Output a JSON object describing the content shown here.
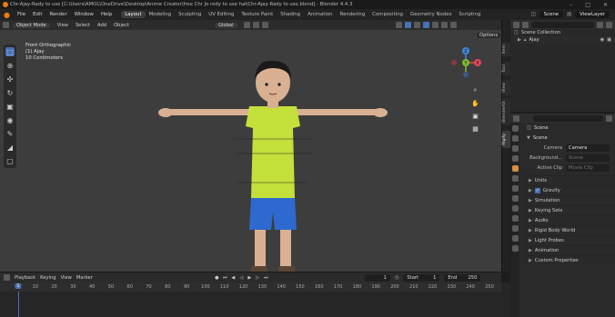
{
  "window": {
    "title": "Chr-Ajay-Rady to use [C:\\Users\\AMOL\\OneDrive\\Desktop\\Anime Creator\\free Chr Jo redy to use hal\\Chr-Ajay-Rady to use.blend] - Blender 4.4.3"
  },
  "menu": [
    "File",
    "Edit",
    "Render",
    "Window",
    "Help"
  ],
  "workspaces": [
    "Layout",
    "Modeling",
    "Sculpting",
    "UV Editing",
    "Texture Paint",
    "Shading",
    "Animation",
    "Rendering",
    "Compositing",
    "Geometry Nodes",
    "Scripting"
  ],
  "active_workspace_index": 0,
  "topbar_right": {
    "scene": "Scene",
    "view_layer": "ViewLayer"
  },
  "viewport_header": {
    "mode": "Object Mode",
    "menus": [
      "View",
      "Select",
      "Add",
      "Object"
    ],
    "orientation": "Global",
    "options": "Options"
  },
  "viewport_info": [
    "Front Orthographic",
    "(1) Ajay",
    "10 Centimeters"
  ],
  "gizmo_axes": {
    "x": "X",
    "y": "Y",
    "z": "Z",
    "x_color": "#e0475a",
    "y_color": "#7dbb2d",
    "z_color": "#3f87e0"
  },
  "n_panel_tabs": [
    "Item",
    "Tool",
    "View",
    "BlenderKit",
    "Rigify"
  ],
  "outliner": {
    "items": [
      "Scene Collection",
      "Ajay"
    ]
  },
  "properties": {
    "header": "Scene",
    "section": "Scene",
    "rows": [
      {
        "label": "Camera",
        "value": "Camera",
        "dim": false
      },
      {
        "label": "Background...",
        "value": "Scene",
        "dim": true
      },
      {
        "label": "Active Clip",
        "value": "Movie Clip",
        "dim": true
      }
    ],
    "subpanels": [
      "Units",
      "Gravity",
      "Simulation",
      "Keying Sets",
      "Audio",
      "Rigid Body World",
      "Light Probes",
      "Animation",
      "Custom Properties"
    ],
    "gravity_checked": true
  },
  "timeline_header": {
    "menus": [
      "Playback",
      "Keying",
      "View",
      "Marker"
    ],
    "current_frame": "1",
    "start_label": "Start",
    "start": "1",
    "end_label": "End",
    "end": "250"
  },
  "timeline_ruler": [
    "1",
    "10",
    "20",
    "30",
    "40",
    "50",
    "60",
    "70",
    "80",
    "90",
    "100",
    "110",
    "120",
    "130",
    "140",
    "150",
    "160",
    "170",
    "180",
    "190",
    "200",
    "210",
    "220",
    "230",
    "240",
    "250"
  ],
  "colors": {
    "accent": "#4772b3",
    "viewport_bg": "#3d3d3d",
    "shirt": "#c4e03a",
    "shorts": "#2d69cf",
    "skin": "#d9b192",
    "hair": "#1a1a1a"
  }
}
